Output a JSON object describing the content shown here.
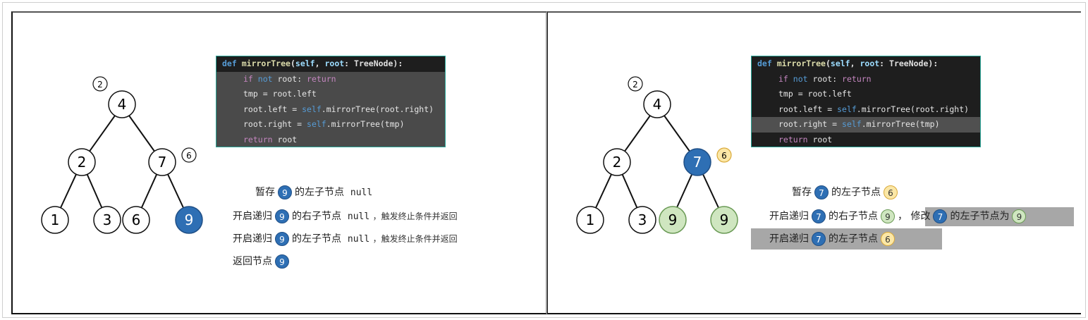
{
  "colors": {
    "node_blue": "#2e6fb4",
    "node_green": "#cfe6c0",
    "badge_yellow": "#fbe7a6",
    "code_border": "#2aa597"
  },
  "code": {
    "header": [
      "def",
      " ",
      "mirrorTree",
      "(",
      "self",
      ", ",
      "root",
      ": TreeNode):"
    ],
    "line1": [
      "if",
      " ",
      "not",
      " root: ",
      "return"
    ],
    "line2": "tmp = root.left",
    "line3": [
      "root.left = ",
      "self",
      ".mirrorTree(root.right)"
    ],
    "line4": [
      "root.right = ",
      "self",
      ".mirrorTree(tmp)"
    ],
    "line5": [
      "return",
      " root"
    ]
  },
  "left": {
    "tree_labels": {
      "root": "4",
      "l": "2",
      "r": "7",
      "ll": "1",
      "lr": "3",
      "rl": "6",
      "rr": "9"
    },
    "annot_root": "2",
    "annot_r": "6",
    "steps": [
      {
        "pre": "暂存",
        "badge": "9",
        "post": "的左子节点",
        "val": "null",
        "tail": ""
      },
      {
        "pre": "开启递归",
        "badge": "9",
        "post": "的右子节点",
        "val": "null",
        "tail": "，触发终止条件并返回"
      },
      {
        "pre": "开启递归",
        "badge": "9",
        "post": "的左子节点",
        "val": "null",
        "tail": "，触发终止条件并返回"
      },
      {
        "pre": "返回节点",
        "badge": "9",
        "post": "",
        "val": "",
        "tail": ""
      }
    ]
  },
  "right": {
    "tree_labels": {
      "root": "4",
      "l": "2",
      "r": "7",
      "ll": "1",
      "lr": "3",
      "rl": "9",
      "rr": "9"
    },
    "annot_root": "2",
    "annot_r": "6",
    "step1": {
      "pre": "暂存",
      "badge": "7",
      "post": "的左子节点",
      "val": "6"
    },
    "step2": {
      "pre": "开启递归",
      "badge": "7",
      "post": "的右子节点",
      "val": "9",
      "sep": "，",
      "mod_pre": "修改",
      "mod_badge": "7",
      "mod_post": "的左子节点为",
      "mod_val": "9"
    },
    "step3": {
      "pre": "开启递归",
      "badge": "7",
      "post": "的左子节点",
      "val": "6"
    }
  }
}
